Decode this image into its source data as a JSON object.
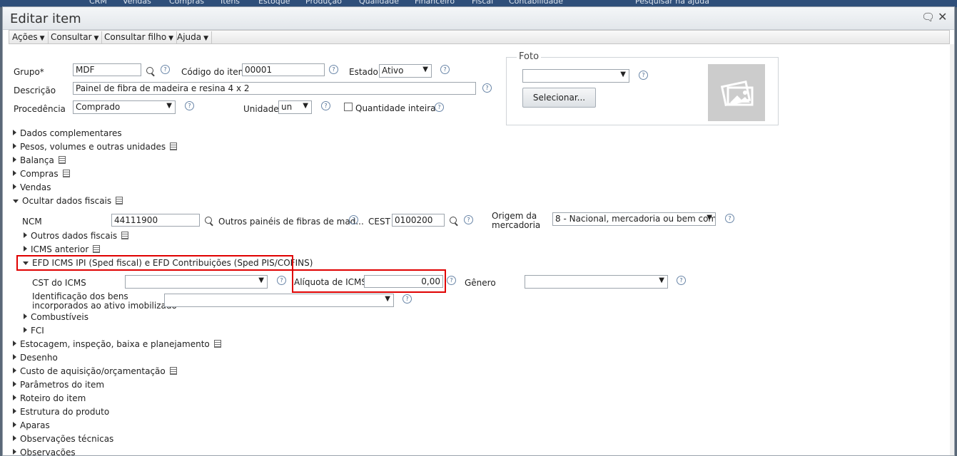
{
  "background_menu": [
    "CRM",
    "Vendas",
    "Compras",
    "Itens",
    "Estoque",
    "Produção",
    "Qualidade",
    "Financeiro",
    "Fiscal",
    "Contabilidade",
    "Pesquisar na ajuda"
  ],
  "dialog": {
    "title": "Editar item"
  },
  "menubar": {
    "acoes": "Ações",
    "consultar": "Consultar",
    "consultar_filho": "Consultar filho",
    "ajuda": "Ajuda"
  },
  "form": {
    "grupo_label": "Grupo*",
    "grupo_value": "MDF",
    "codigo_label": "Código do item",
    "codigo_value": "00001",
    "estado_label": "Estado",
    "estado_value": "Ativo",
    "descricao_label": "Descrição",
    "descricao_value": "Painel de fibra de madeira e resina 4 x 2",
    "procedencia_label": "Procedência",
    "procedencia_value": "Comprado",
    "unidade_label": "Unidade",
    "unidade_value": "un",
    "quantidade_inteira_label": "Quantidade inteira"
  },
  "foto": {
    "legend": "Foto",
    "select_value": "",
    "button": "Selecionar..."
  },
  "sections_top": [
    "Dados complementares",
    "Pesos, volumes e outras unidades",
    "Balança",
    "Compras",
    "Vendas",
    "Ocultar dados fiscais"
  ],
  "fiscal": {
    "ncm_label": "NCM",
    "ncm_value": "44111900",
    "ncm_desc": "Outros painéis de fibras de mad...",
    "cest_label": "CEST",
    "cest_value": "0100200",
    "origem_label_1": "Origem da",
    "origem_label_2": "mercadoria",
    "origem_value": "8 - Nacional, mercadoria ou bem com",
    "outros_dados": "Outros dados fiscais",
    "icms_anterior": "ICMS anterior",
    "efd": "EFD ICMS IPI (Sped fiscal) e EFD Contribuições (Sped PIS/COFINS)",
    "cst_label": "CST do ICMS",
    "cst_value": "",
    "aliquota_label": "Alíquota de ICMS",
    "aliquota_value": "0,00",
    "genero_label": "Gênero",
    "genero_value": "",
    "bens_label_1": "Identificação dos bens",
    "bens_label_2": "incorporados ao ativo imobilizado",
    "bens_value": "",
    "combustiveis": "Combustíveis",
    "fci": "FCI"
  },
  "sections_bottom": [
    "Estocagem, inspeção, baixa e planejamento",
    "Desenho",
    "Custo de aquisição/orçamentação",
    "Parâmetros do item",
    "Roteiro do item",
    "Estrutura do produto",
    "Aparas",
    "Observações técnicas",
    "Observações"
  ],
  "colors": {
    "highlight": "#e00000",
    "titlebar": "#e3e7eb"
  }
}
